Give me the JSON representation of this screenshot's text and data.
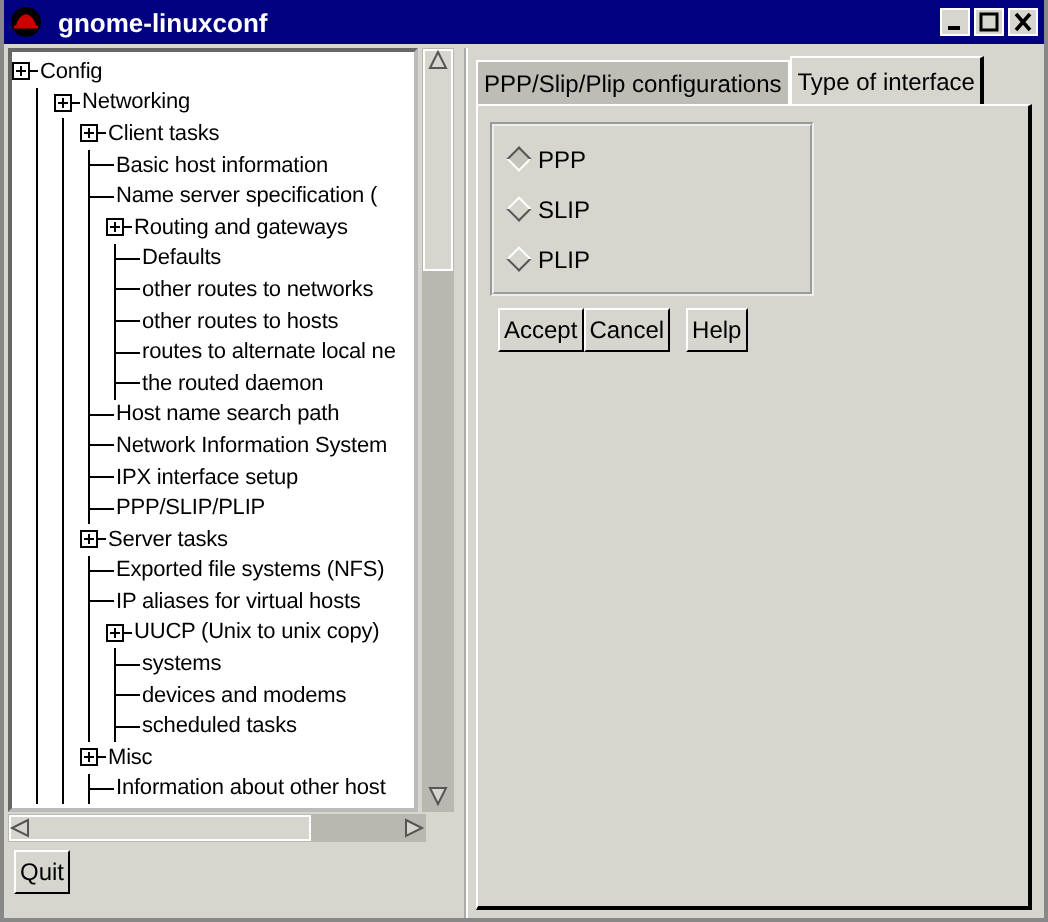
{
  "window": {
    "title": "gnome-linuxconf"
  },
  "tree": [
    {
      "label": "Config",
      "children": [
        {
          "label": "Networking",
          "children": [
            {
              "label": "Client tasks",
              "children": [
                {
                  "label": "Basic host information"
                },
                {
                  "label": "Name server specification ("
                },
                {
                  "label": "Routing and gateways",
                  "children": [
                    {
                      "label": "Defaults"
                    },
                    {
                      "label": "other routes to networks"
                    },
                    {
                      "label": "other routes to hosts"
                    },
                    {
                      "label": "routes to alternate local ne"
                    },
                    {
                      "label": "the routed daemon"
                    }
                  ]
                },
                {
                  "label": "Host name search path"
                },
                {
                  "label": "Network Information System"
                },
                {
                  "label": "IPX interface setup"
                },
                {
                  "label": "PPP/SLIP/PLIP"
                }
              ]
            },
            {
              "label": "Server tasks",
              "children": [
                {
                  "label": "Exported file systems (NFS)"
                },
                {
                  "label": "IP aliases for virtual hosts"
                },
                {
                  "label": "UUCP (Unix to unix copy)",
                  "children": [
                    {
                      "label": "systems"
                    },
                    {
                      "label": "devices and modems"
                    },
                    {
                      "label": "scheduled tasks"
                    }
                  ]
                }
              ]
            },
            {
              "label": "Misc",
              "children": [
                {
                  "label": "Information about other host"
                }
              ]
            }
          ]
        }
      ]
    }
  ],
  "quit_button": "Quit",
  "tabs": [
    {
      "label": "PPP/Slip/Plip configurations",
      "selected": false
    },
    {
      "label": "Type of interface",
      "selected": true
    }
  ],
  "options": [
    {
      "label": "PPP",
      "selected": true
    },
    {
      "label": "SLIP",
      "selected": false
    },
    {
      "label": "PLIP",
      "selected": false
    }
  ],
  "buttons": [
    "Accept",
    "Cancel",
    "Help"
  ]
}
